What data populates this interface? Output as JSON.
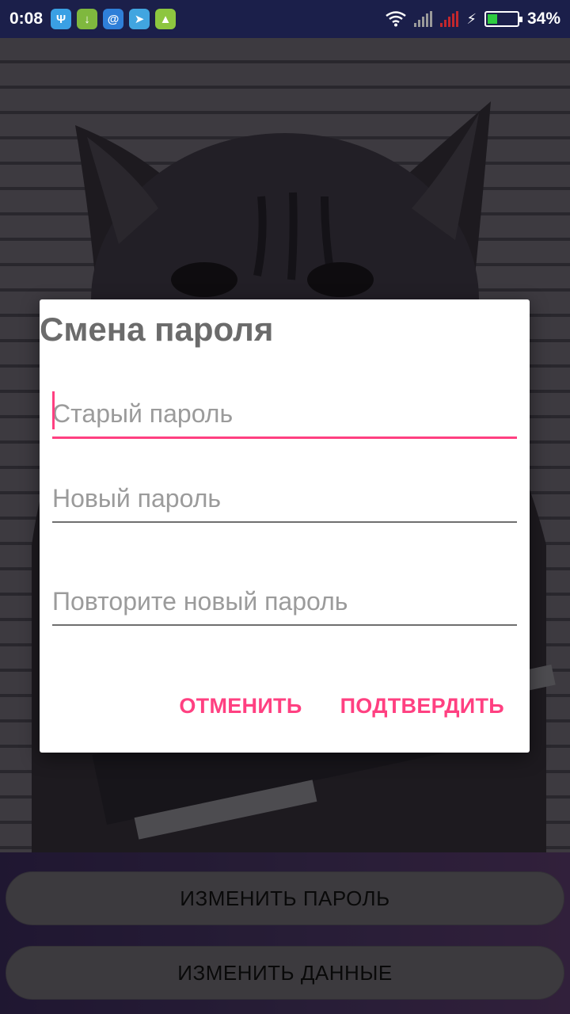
{
  "status_bar": {
    "time": "0:08",
    "battery": "34%",
    "battery_level": 0.34,
    "notifications": [
      {
        "icon": "usb-icon",
        "glyph": "Ψ",
        "color": "#3aa0e4"
      },
      {
        "icon": "download-icon",
        "glyph": "↓",
        "color": "#7fb83e"
      },
      {
        "icon": "mail-icon",
        "glyph": "@",
        "color": "#2f7fd8"
      },
      {
        "icon": "telegram-icon",
        "glyph": "➤",
        "color": "#41a5e0"
      },
      {
        "icon": "android-icon",
        "glyph": "▲",
        "color": "#8dc63f"
      }
    ]
  },
  "dialog": {
    "title": "Смена пароля",
    "fields": [
      {
        "placeholder": "Старый пароль"
      },
      {
        "placeholder": "Новый пароль"
      },
      {
        "placeholder": "Повторите новый пароль"
      }
    ],
    "cancel_label": "ОТМЕНИТЬ",
    "confirm_label": "ПОДТВЕРДИТЬ"
  },
  "bottom": {
    "change_password_label": "ИЗМЕНИТЬ ПАРОЛЬ",
    "change_data_label": "ИЗМЕНИТЬ ДАННЫЕ"
  },
  "colors": {
    "accent": "#ff4081",
    "status_bar": "#1b1f4a"
  }
}
